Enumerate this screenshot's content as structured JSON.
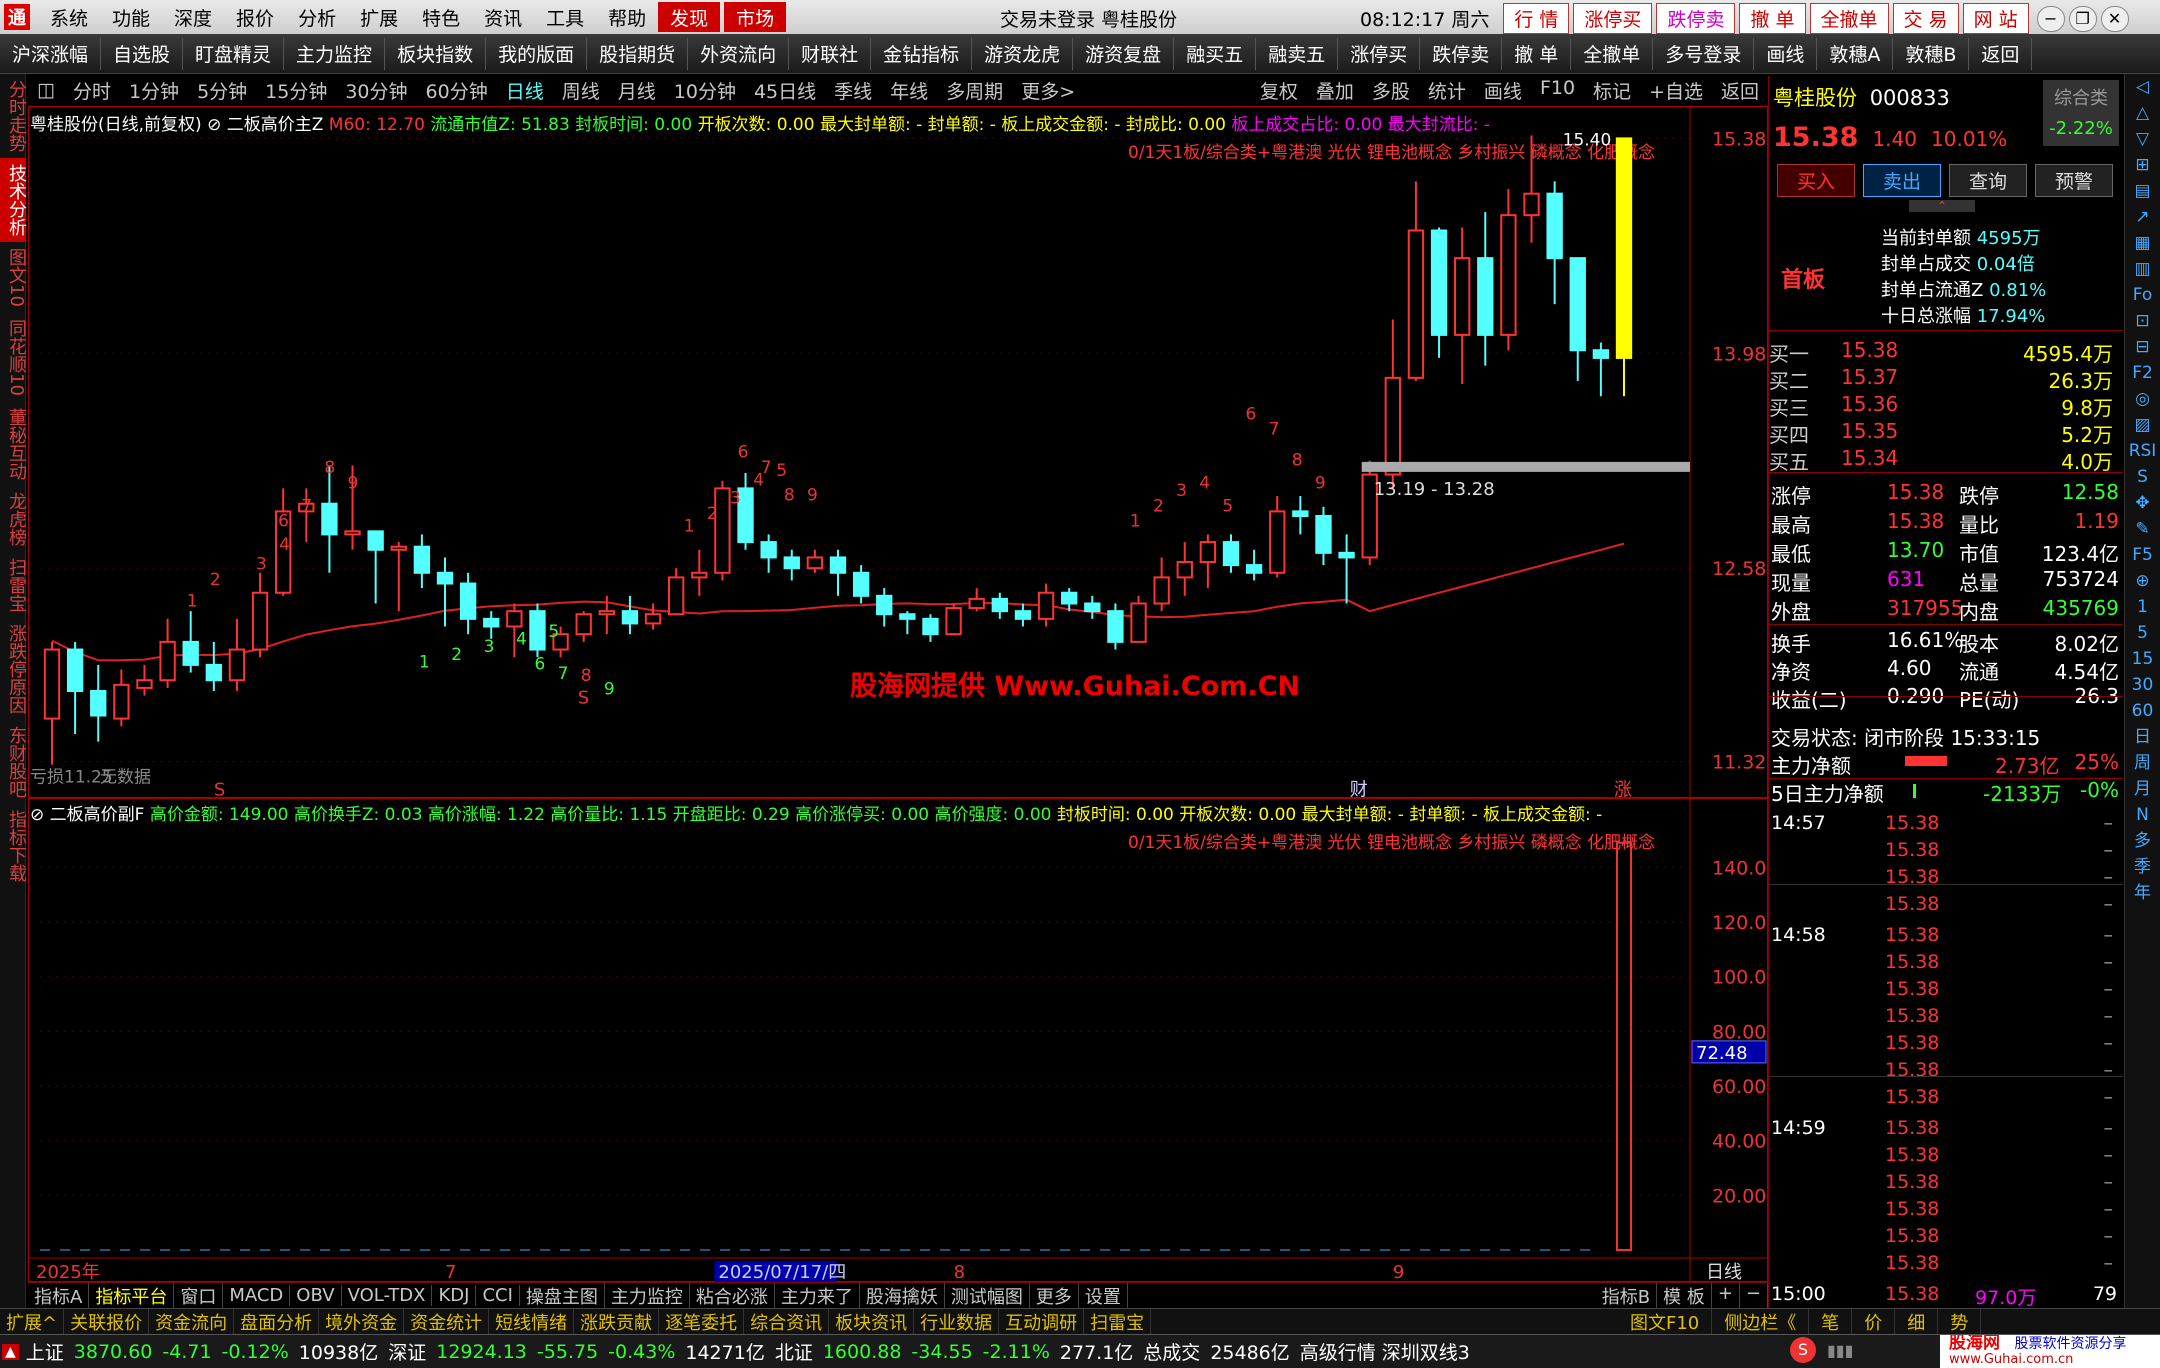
{
  "titlebar": {
    "logo": "通",
    "menu": [
      "系统",
      "功能",
      "深度",
      "报价",
      "分析",
      "扩展",
      "特色",
      "资讯",
      "工具",
      "帮助"
    ],
    "tab_find": "发现",
    "tab_market": "市场",
    "status": "交易未登录  粤桂股份",
    "clock": "08:12:17 周六",
    "buttons": [
      "行 情",
      "涨停买",
      "跌停卖",
      "撤 单",
      "全撤单",
      "交 易",
      "网 站"
    ]
  },
  "toolbar": [
    "沪深涨幅",
    "自选股",
    "盯盘精灵",
    "主力监控",
    "板块指数",
    "我的版面",
    "股指期货",
    "外资流向",
    "财联社",
    "金钻指标",
    "游资龙虎",
    "游资复盘",
    "融买五",
    "融卖五",
    "涨停买",
    "跌停卖",
    "撤 单",
    "全撤单",
    "多号登录",
    "画线",
    "敦穗A",
    "敦穗B",
    "返回"
  ],
  "leftbar": [
    "分时走势",
    "技术分析",
    "图文10",
    "同花顺10",
    "董秘互动",
    "龙虎榜",
    "扫雷宝",
    "涨跌停原因",
    "东财股吧",
    "指标下载"
  ],
  "periods": [
    "分时",
    "1分钟",
    "5分钟",
    "15分钟",
    "30分钟",
    "60分钟",
    "日线",
    "周线",
    "月线",
    "10分钟",
    "45日线",
    "季线",
    "年线",
    "多周期",
    "更多>"
  ],
  "period_active": "日线",
  "period_right": [
    "复权",
    "叠加",
    "多股",
    "统计",
    "画线",
    "F10",
    "标记",
    "+自选",
    "返回"
  ],
  "main_head": {
    "name": "粤桂股份(日线,前复权)",
    "ind": "二板高价主Z",
    "m60": "M60: 12.70",
    "f1": "流通市值Z: 51.83",
    "f2": "封板时间: 0.00",
    "f3": "开板次数: 0.00",
    "f4": "最大封单额: -",
    "f5": "封单额: -",
    "f6": "板上成交金额: -",
    "f7": "封成比: 0.00",
    "f8": "板上成交占比: 0.00",
    "f9": "最大封流比: -"
  },
  "concept_line": "0/1天1板/综合类+粤港澳 光伏 锂电池概念 乡村振兴 磷概念 化肥概念",
  "sub_head": {
    "name": "二板高价副F",
    "f1": "高价金额: 149.00",
    "f2": "高价换手Z: 0.03",
    "f3": "高价涨幅: 1.22",
    "f4": "高价量比: 1.15",
    "f5": "开盘距比: 0.29",
    "f6": "高价涨停买: 0.00",
    "f7": "高价强度: 0.00",
    "f8": "封板时间: 0.00",
    "f9": "开板次数: 0.00",
    "f10": "最大封单额: -",
    "f11": "封单额: -",
    "f12": "板上成交金额: -"
  },
  "price_labels": [
    "15.38",
    "13.98",
    "12.58",
    "11.32"
  ],
  "sub_labels": [
    "140.0",
    "120.0",
    "100.0",
    "80.00",
    "60.00",
    "40.00",
    "20.00"
  ],
  "sub_cursor": "72.48",
  "annot_high": "15.40",
  "annot_support": "13.19 - 13.28",
  "annot_loss": "亏损11.25",
  "annot_nodata": "无数据",
  "watermark": "股海网提供 Www.Guhai.Com.CN",
  "x_labels": [
    "2025年",
    "7",
    "2025/07/17/四",
    "8",
    "9"
  ],
  "x_period": "日线",
  "markers": {
    "s": "S",
    "cai": "财",
    "zhang": "涨"
  },
  "td_red_top": [
    "6",
    "7",
    "8",
    "9"
  ],
  "td_green": [
    "1",
    "2",
    "3",
    "4",
    "5",
    "6",
    "7",
    "8",
    "9"
  ],
  "td_counts": [
    "1",
    "2",
    "3",
    "4",
    "5",
    "6",
    "7",
    "8",
    "9"
  ],
  "chart_data": {
    "type": "candlestick",
    "series": [
      {
        "values": [
          [
            11.6,
            12.05,
            12.1,
            11.3
          ],
          [
            12.05,
            11.78,
            12.1,
            11.5
          ],
          [
            11.78,
            11.62,
            11.95,
            11.45
          ],
          [
            11.6,
            11.82,
            11.92,
            11.55
          ],
          [
            11.8,
            11.85,
            11.95,
            11.75
          ],
          [
            11.85,
            12.1,
            12.25,
            11.8
          ],
          [
            12.1,
            11.95,
            12.3,
            11.9
          ],
          [
            11.95,
            11.85,
            12.1,
            11.78
          ],
          [
            11.85,
            12.05,
            12.25,
            11.78
          ],
          [
            12.05,
            12.42,
            12.55,
            12.0
          ],
          [
            12.42,
            12.95,
            13.1,
            12.4
          ],
          [
            12.95,
            13.0,
            13.1,
            12.75
          ],
          [
            13.0,
            12.8,
            13.25,
            12.55
          ],
          [
            12.8,
            12.82,
            13.25,
            12.7
          ],
          [
            12.82,
            12.7,
            12.8,
            12.35
          ],
          [
            12.7,
            12.72,
            12.75,
            12.3
          ],
          [
            12.72,
            12.55,
            12.8,
            12.45
          ],
          [
            12.55,
            12.48,
            12.65,
            12.2
          ],
          [
            12.48,
            12.25,
            12.55,
            12.15
          ],
          [
            12.25,
            12.2,
            12.3,
            12.12
          ],
          [
            12.2,
            12.3,
            12.35,
            12.0
          ],
          [
            12.3,
            12.05,
            12.35,
            12.0
          ],
          [
            12.05,
            12.15,
            12.2,
            12.0
          ],
          [
            12.15,
            12.28,
            12.3,
            12.1
          ],
          [
            12.28,
            12.3,
            12.4,
            12.15
          ],
          [
            12.3,
            12.22,
            12.4,
            12.15
          ],
          [
            12.22,
            12.28,
            12.35,
            12.18
          ],
          [
            12.28,
            12.52,
            12.58,
            12.28
          ],
          [
            12.52,
            12.55,
            12.7,
            12.4
          ],
          [
            12.55,
            13.1,
            13.15,
            12.5
          ],
          [
            13.1,
            12.75,
            13.2,
            12.7
          ],
          [
            12.75,
            12.65,
            12.8,
            12.55
          ],
          [
            12.65,
            12.58,
            12.7,
            12.5
          ],
          [
            12.58,
            12.65,
            12.7,
            12.55
          ],
          [
            12.65,
            12.55,
            12.7,
            12.4
          ],
          [
            12.55,
            12.4,
            12.6,
            12.35
          ],
          [
            12.4,
            12.28,
            12.45,
            12.2
          ],
          [
            12.28,
            12.25,
            12.3,
            12.15
          ],
          [
            12.25,
            12.15,
            12.28,
            12.1
          ],
          [
            12.15,
            12.32,
            12.35,
            12.15
          ],
          [
            12.32,
            12.38,
            12.45,
            12.3
          ],
          [
            12.38,
            12.3,
            12.42,
            12.25
          ],
          [
            12.3,
            12.25,
            12.35,
            12.2
          ],
          [
            12.25,
            12.42,
            12.48,
            12.2
          ],
          [
            12.42,
            12.35,
            12.45,
            12.3
          ],
          [
            12.35,
            12.3,
            12.4,
            12.25
          ],
          [
            12.3,
            12.1,
            12.35,
            12.05
          ],
          [
            12.1,
            12.35,
            12.4,
            12.1
          ],
          [
            12.35,
            12.52,
            12.65,
            12.3
          ],
          [
            12.52,
            12.62,
            12.75,
            12.4
          ],
          [
            12.62,
            12.75,
            12.8,
            12.45
          ],
          [
            12.75,
            12.6,
            12.8,
            12.55
          ],
          [
            12.6,
            12.55,
            12.7,
            12.5
          ],
          [
            12.55,
            12.95,
            13.05,
            12.52
          ],
          [
            12.95,
            12.92,
            13.05,
            12.8
          ],
          [
            12.92,
            12.68,
            12.98,
            12.6
          ],
          [
            12.68,
            12.65,
            12.8,
            12.35
          ],
          [
            12.65,
            13.19,
            13.28,
            12.6
          ],
          [
            13.19,
            13.82,
            14.2,
            13.1
          ],
          [
            13.82,
            14.78,
            15.1,
            13.8
          ],
          [
            14.78,
            14.1,
            14.8,
            13.95
          ],
          [
            14.1,
            14.6,
            14.8,
            13.78
          ],
          [
            14.6,
            14.1,
            14.9,
            13.9
          ],
          [
            14.1,
            14.88,
            15.05,
            14.0
          ],
          [
            14.88,
            15.02,
            15.4,
            14.7
          ],
          [
            15.02,
            14.6,
            15.1,
            14.3
          ],
          [
            14.6,
            14.0,
            14.6,
            13.8
          ],
          [
            14.0,
            13.95,
            14.05,
            13.7
          ],
          [
            13.95,
            15.38,
            15.38,
            13.7
          ]
        ]
      }
    ],
    "ma": {
      "name": "M60",
      "last": 12.7
    },
    "ylim": [
      11.2,
      15.5
    ],
    "volume_last": 149.0,
    "sub_ylim": [
      0,
      150
    ]
  },
  "quote": {
    "name": "粤桂股份",
    "code": "000833",
    "category": "综合类",
    "category_pct": "-2.22%",
    "price": "15.38",
    "change": "1.40",
    "pct": "10.01%",
    "buttons": [
      "买入",
      "卖出",
      "查询",
      "预警"
    ],
    "board": "首板",
    "seal": [
      [
        "当前封单额",
        "4595万"
      ],
      [
        "封单占成交",
        "0.04倍"
      ],
      [
        "封单占流通Z",
        "0.81%"
      ],
      [
        "十日总涨幅",
        "17.94%"
      ]
    ],
    "book": [
      [
        "买一",
        "15.38",
        "4595.4万"
      ],
      [
        "买二",
        "15.37",
        "26.3万"
      ],
      [
        "买三",
        "15.36",
        "9.8万"
      ],
      [
        "买四",
        "15.35",
        "5.2万"
      ],
      [
        "买五",
        "15.34",
        "4.0万"
      ]
    ],
    "stats": [
      [
        "涨停",
        "15.38",
        "跌停",
        "12.58"
      ],
      [
        "最高",
        "15.38",
        "量比",
        "1.19"
      ],
      [
        "最低",
        "13.70",
        "市值",
        "123.4亿"
      ],
      [
        "现量",
        "631",
        "总量",
        "753724"
      ],
      [
        "外盘",
        "317955",
        "内盘",
        "435769"
      ]
    ],
    "stats2": [
      [
        "换手",
        "16.61%",
        "股本",
        "8.02亿"
      ],
      [
        "净资",
        "4.60",
        "流通",
        "4.54亿"
      ],
      [
        "收益(二)",
        "0.290",
        "PE(动)",
        "26.3"
      ]
    ],
    "trade_state": "交易状态: 闭市阶段 15:33:15",
    "main_net": [
      "主力净额",
      "2.73亿",
      "25%"
    ],
    "main_net5": [
      "5日主力净额",
      "-2133万",
      "-0%"
    ],
    "ticks": [
      [
        "14:57",
        "15.38"
      ],
      [
        "",
        "15.38"
      ],
      [
        "",
        "15.38"
      ],
      [
        "",
        "15.38"
      ],
      [
        "14:58",
        "15.38"
      ],
      [
        "",
        "15.38"
      ],
      [
        "",
        "15.38"
      ],
      [
        "",
        "15.38"
      ],
      [
        "",
        "15.38"
      ],
      [
        "",
        "15.38"
      ],
      [
        "",
        "15.38"
      ],
      [
        "14:59",
        "15.38"
      ],
      [
        "",
        "15.38"
      ],
      [
        "",
        "15.38"
      ],
      [
        "",
        "15.38"
      ],
      [
        "",
        "15.38"
      ],
      [
        "",
        "15.38"
      ],
      [
        "15:00",
        "15.38",
        "97.0万",
        "79"
      ]
    ]
  },
  "bottombar1": [
    "指标A",
    "指标平台",
    "窗口",
    "MACD",
    "OBV",
    "VOL-TDX",
    "KDJ",
    "CCI",
    "操盘主图",
    "主力监控",
    "粘合必涨",
    "主力来了",
    "股海擒妖",
    "测试幅图",
    "更多",
    "设置"
  ],
  "bottombar1_right": [
    "指标B",
    "模 板",
    "+",
    "−"
  ],
  "bottombar2": [
    "扩展^",
    "关联报价",
    "资金流向",
    "盘面分析",
    "境外资金",
    "资金统计",
    "短线情绪",
    "涨跌贡献",
    "逐笔委托",
    "综合资讯",
    "板块资讯",
    "行业数据",
    "互动调研",
    "扫雷宝"
  ],
  "bottombar2_right": [
    "图文F10",
    "侧边栏《",
    "笔",
    "价",
    "细",
    "势"
  ],
  "statusbar": {
    "sh": [
      "上证",
      "3870.60",
      "-4.71",
      "-0.12%",
      "10938亿"
    ],
    "sz": [
      "深证",
      "12924.13",
      "-55.75",
      "-0.43%",
      "14271亿"
    ],
    "bj": [
      "北证",
      "1600.88",
      "-34.55",
      "-2.11%",
      "277.1亿"
    ],
    "total": [
      "总成交",
      "25486亿"
    ],
    "mode": "高级行情  深圳双线3",
    "brand": "股海网",
    "brand_sub": "股票软件资源分享",
    "brand_url": "www.Guhai.com.cn"
  },
  "rightbar": [
    "◁",
    "△",
    "▽",
    "⊞",
    "▤",
    "↗",
    "▦",
    "▥",
    "Fo",
    "⊡",
    "⊟",
    "F2",
    "◎",
    "▨",
    "RSI",
    "S",
    "✥",
    "✎",
    "F5",
    "⊕",
    "1",
    "5",
    "15",
    "30",
    "60",
    "日",
    "周",
    "月",
    "N",
    "多",
    "季",
    "年"
  ],
  "colors": {
    "up": "#ff3333",
    "down": "#54ffff",
    "limit": "#ffff00",
    "ma": "#e02020",
    "frame": "#aa0000"
  }
}
